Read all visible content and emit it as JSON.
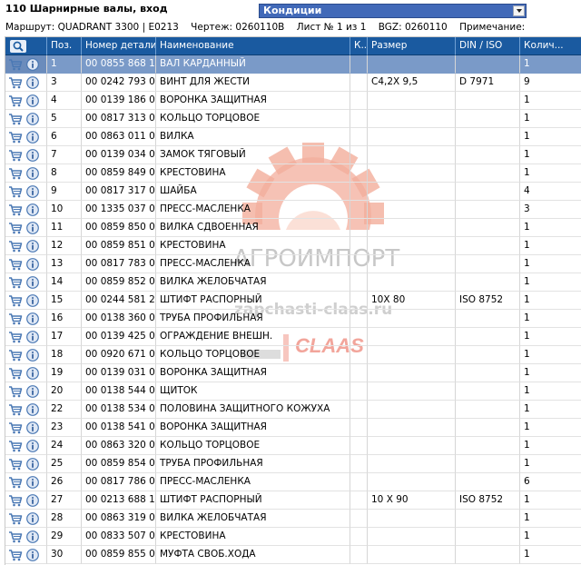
{
  "header": {
    "title": "110 Шарнирные валы, вход",
    "condition_label": "Кондиции"
  },
  "route": {
    "route": "Маршрут: QUADRANT 3300 | E0213",
    "drawing": "Чертеж: 0260110B",
    "sheet": "Лист № 1 из 1",
    "bgz": "BGZ: 0260110",
    "note": "Примечание:"
  },
  "columns": {
    "pos": "Поз.",
    "part": "Номер детали",
    "name": "Наименование",
    "k": "К..",
    "size": "Размер",
    "din": "DIN / ISO",
    "qty": "Колич..."
  },
  "rows": [
    {
      "pos": "1",
      "part": "00 0855 868 1",
      "name": "ВАЛ КАРДАННЫЙ",
      "size": "",
      "din": "",
      "qty": "1"
    },
    {
      "pos": "3",
      "part": "00 0242 793 0",
      "name": "ВИНТ ДЛЯ ЖЕСТИ",
      "size": "C4,2X 9,5",
      "din": "D 7971",
      "qty": "9"
    },
    {
      "pos": "4",
      "part": "00 0139 186 0",
      "name": "ВОРОНКА ЗАЩИТНАЯ",
      "size": "",
      "din": "",
      "qty": "1"
    },
    {
      "pos": "5",
      "part": "00 0817 313 0",
      "name": "КОЛЬЦО ТОРЦОВОЕ",
      "size": "",
      "din": "",
      "qty": "1"
    },
    {
      "pos": "6",
      "part": "00 0863 011 0",
      "name": "ВИЛКА",
      "size": "",
      "din": "",
      "qty": "1"
    },
    {
      "pos": "7",
      "part": "00 0139 034 0",
      "name": "ЗАМОК ТЯГОВЫЙ",
      "size": "",
      "din": "",
      "qty": "1"
    },
    {
      "pos": "8",
      "part": "00 0859 849 0",
      "name": "КРЕСТОВИНА",
      "size": "",
      "din": "",
      "qty": "1"
    },
    {
      "pos": "9",
      "part": "00 0817 317 0",
      "name": "ШАЙБА",
      "size": "",
      "din": "",
      "qty": "4"
    },
    {
      "pos": "10",
      "part": "00 1335 037 0",
      "name": "ПРЕСС-МАСЛЕНКА",
      "size": "",
      "din": "",
      "qty": "3"
    },
    {
      "pos": "11",
      "part": "00 0859 850 0",
      "name": "ВИЛКА СДВОЕННАЯ",
      "size": "",
      "din": "",
      "qty": "1"
    },
    {
      "pos": "12",
      "part": "00 0859 851 0",
      "name": "КРЕСТОВИНА",
      "size": "",
      "din": "",
      "qty": "1"
    },
    {
      "pos": "13",
      "part": "00 0817 783 0",
      "name": "ПРЕСС-МАСЛЕНКА",
      "size": "",
      "din": "",
      "qty": "1"
    },
    {
      "pos": "14",
      "part": "00 0859 852 0",
      "name": "ВИЛКА ЖЕЛОБЧАТАЯ",
      "size": "",
      "din": "",
      "qty": "1"
    },
    {
      "pos": "15",
      "part": "00 0244 581 2",
      "name": "ШТИФТ РАСПОРНЫЙ",
      "size": "10X 80",
      "din": "ISO 8752",
      "qty": "1"
    },
    {
      "pos": "16",
      "part": "00 0138 360 0",
      "name": "ТРУБА ПРОФИЛЬНАЯ",
      "size": "",
      "din": "",
      "qty": "1"
    },
    {
      "pos": "17",
      "part": "00 0139 425 0",
      "name": "ОГРАЖДЕНИЕ ВНЕШН.",
      "size": "",
      "din": "",
      "qty": "1"
    },
    {
      "pos": "18",
      "part": "00 0920 671 0",
      "name": "КОЛЬЦО ТОРЦОВОЕ",
      "size": "",
      "din": "",
      "qty": "1"
    },
    {
      "pos": "19",
      "part": "00 0139 031 0",
      "name": "ВОРОНКА ЗАЩИТНАЯ",
      "size": "",
      "din": "",
      "qty": "1"
    },
    {
      "pos": "20",
      "part": "00 0138 544 0",
      "name": "ЩИТОК",
      "size": "",
      "din": "",
      "qty": "1"
    },
    {
      "pos": "22",
      "part": "00 0138 534 0",
      "name": "ПОЛОВИНА ЗАЩИТНОГО КОЖУХА",
      "size": "",
      "din": "",
      "qty": "1"
    },
    {
      "pos": "23",
      "part": "00 0138 541 0",
      "name": "ВОРОНКА ЗАЩИТНАЯ",
      "size": "",
      "din": "",
      "qty": "1"
    },
    {
      "pos": "24",
      "part": "00 0863 320 0",
      "name": "КОЛЬЦО ТОРЦОВОЕ",
      "size": "",
      "din": "",
      "qty": "1"
    },
    {
      "pos": "25",
      "part": "00 0859 854 0",
      "name": "ТРУБА ПРОФИЛЬНАЯ",
      "size": "",
      "din": "",
      "qty": "1"
    },
    {
      "pos": "26",
      "part": "00 0817 786 0",
      "name": "ПРЕСС-МАСЛЕНКА",
      "size": "",
      "din": "",
      "qty": "6"
    },
    {
      "pos": "27",
      "part": "00 0213 688 1",
      "name": "ШТИФТ РАСПОРНЫЙ",
      "size": "10  X 90",
      "din": "ISO 8752",
      "qty": "1"
    },
    {
      "pos": "28",
      "part": "00 0863 319 0",
      "name": "ВИЛКА ЖЕЛОБЧАТАЯ",
      "size": "",
      "din": "",
      "qty": "1"
    },
    {
      "pos": "29",
      "part": "00 0833 507 0",
      "name": "КРЕСТОВИНА",
      "size": "",
      "din": "",
      "qty": "1"
    },
    {
      "pos": "30",
      "part": "00 0859 855 0",
      "name": "МУФТА СВОБ.ХОДА",
      "size": "",
      "din": "",
      "qty": "1"
    }
  ],
  "watermark": {
    "brand": "АГРОИМПОРТ",
    "site": "zapchasti-claas.ru",
    "claas": "CLAAS"
  },
  "colors": {
    "header_bg": "#1a5aa0",
    "selected_row": "#7a9ac8",
    "condition_select": "#4169b8"
  },
  "icons": {
    "header_icon": "search-icon",
    "row_icon_1": "cart-icon",
    "row_icon_2": "info-icon"
  }
}
